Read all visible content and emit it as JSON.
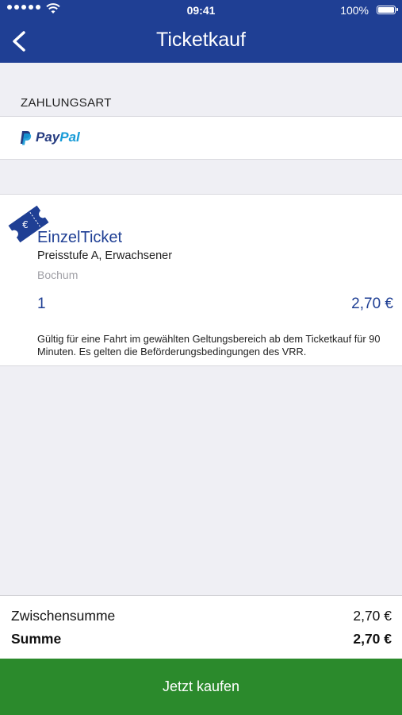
{
  "status_bar": {
    "time": "09:41",
    "battery": "100%"
  },
  "nav": {
    "title": "Ticketkauf",
    "back_icon": "chevron-left-icon"
  },
  "payment": {
    "section_header": "ZAHLUNGSART",
    "method_pay": "Pay",
    "method_pal": "Pal"
  },
  "ticket": {
    "name": "EinzelTicket",
    "description": "Preisstufe A, Erwachsener",
    "city": "Bochum",
    "quantity": "1",
    "price": "2,70 €",
    "validity": "Gültig für eine Fahrt im gewählten Geltungsbereich ab dem Ticketkauf für 90 Minuten. Es gelten die Beförderungsbedingungen des VRR.",
    "icon": "ticket-euro-icon",
    "icon_currency": "€"
  },
  "totals": {
    "subtotal_label": "Zwischensumme",
    "subtotal_value": "2,70 €",
    "total_label": "Summe",
    "total_value": "2,70 €"
  },
  "buy_button": {
    "label": "Jetzt kaufen"
  },
  "colors": {
    "brand_blue": "#1f3f94",
    "buy_green": "#2b8a2c",
    "background": "#efeff4"
  }
}
